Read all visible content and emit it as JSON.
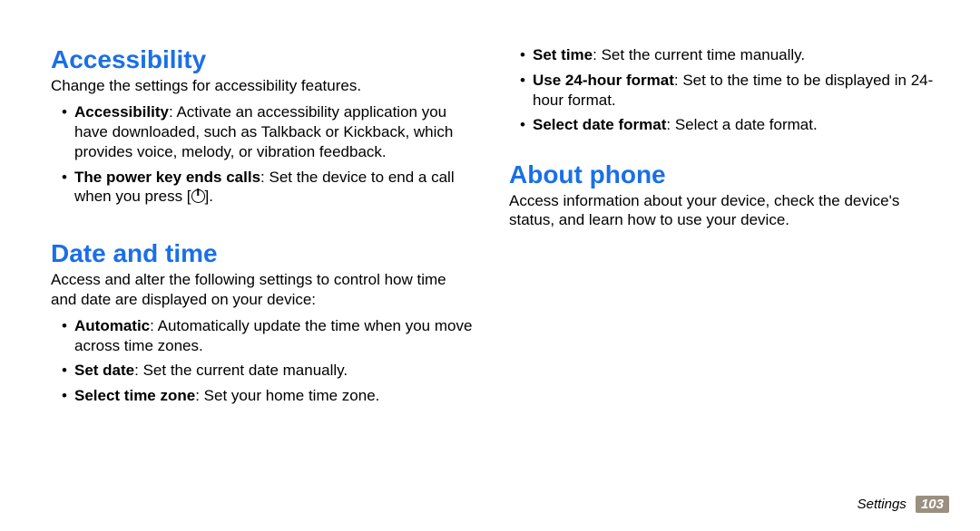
{
  "left": {
    "accessibility": {
      "heading": "Accessibility",
      "intro": "Change the settings for accessibility features.",
      "items": [
        {
          "label": "Accessibility",
          "text": ": Activate an accessibility application you have downloaded, such as Talkback or Kickback, which provides voice, melody, or vibration feedback."
        },
        {
          "label": "The power key ends calls",
          "text_before": ": Set the device to end a call when you press [",
          "text_after": "]."
        }
      ]
    },
    "datetime": {
      "heading": "Date and time",
      "intro": "Access and alter the following settings to control how time and date are displayed on your device:",
      "items": [
        {
          "label": "Automatic",
          "text": ": Automatically update the time when you move across time zones."
        },
        {
          "label": "Set date",
          "text": ": Set the current date manually."
        },
        {
          "label": "Select time zone",
          "text": ": Set your home time zone."
        }
      ]
    }
  },
  "right": {
    "datetime_cont": {
      "items": [
        {
          "label": "Set time",
          "text": ": Set the current time manually."
        },
        {
          "label": "Use 24-hour format",
          "text": ": Set to the time to be displayed in 24-hour format."
        },
        {
          "label": "Select date format",
          "text": ": Select a date format."
        }
      ]
    },
    "about": {
      "heading": "About phone",
      "intro": "Access information about your device, check the device's status, and learn how to use your device."
    }
  },
  "footer": {
    "section": "Settings",
    "page": "103"
  }
}
